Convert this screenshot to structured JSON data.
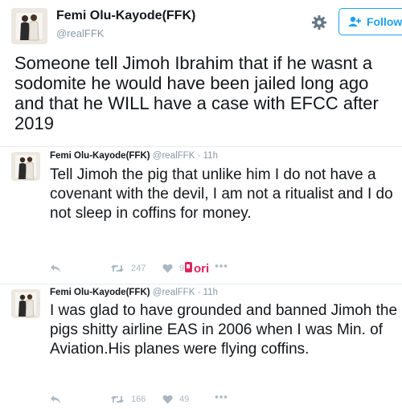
{
  "main_tweet": {
    "display_name": "Femi Olu-Kayode(FFK)",
    "handle": "@realFFK",
    "follow_label": "Follow",
    "text": "Someone tell Jimoh Ibrahim that if he wasnt a sodomite he would have been jailed long ago and that he WILL have a case with EFCC after 2019"
  },
  "replies": [
    {
      "display_name": "Femi Olu-Kayode(FFK)",
      "handle": "@realFFK",
      "separator": "·",
      "time": "11h",
      "text": "Tell Jimoh the pig that unlike  him I do not have a covenant with the devil, I am not a ritualist and I do not sleep in coffins for money.",
      "retweets": "247",
      "likes": "95"
    },
    {
      "display_name": "Femi Olu-Kayode(FFK)",
      "handle": "@realFFK",
      "separator": "·",
      "time": "11h",
      "text": "I was glad to have grounded and banned Jimoh the pigs shitty airline EAS in 2006 when I was Min. of Aviation.His planes were flying coffins.",
      "retweets": "166",
      "likes": "49"
    }
  ],
  "watermark": {
    "text": "pori"
  },
  "icons": [
    "gear-icon",
    "add-user-icon",
    "reply-icon",
    "retweet-icon",
    "heart-icon",
    "more-icon"
  ],
  "colors": {
    "accent": "#1da1f2",
    "text": "#14171a",
    "muted": "#8899a6",
    "icon": "#aab8c2",
    "watermark": "#e0245e"
  }
}
